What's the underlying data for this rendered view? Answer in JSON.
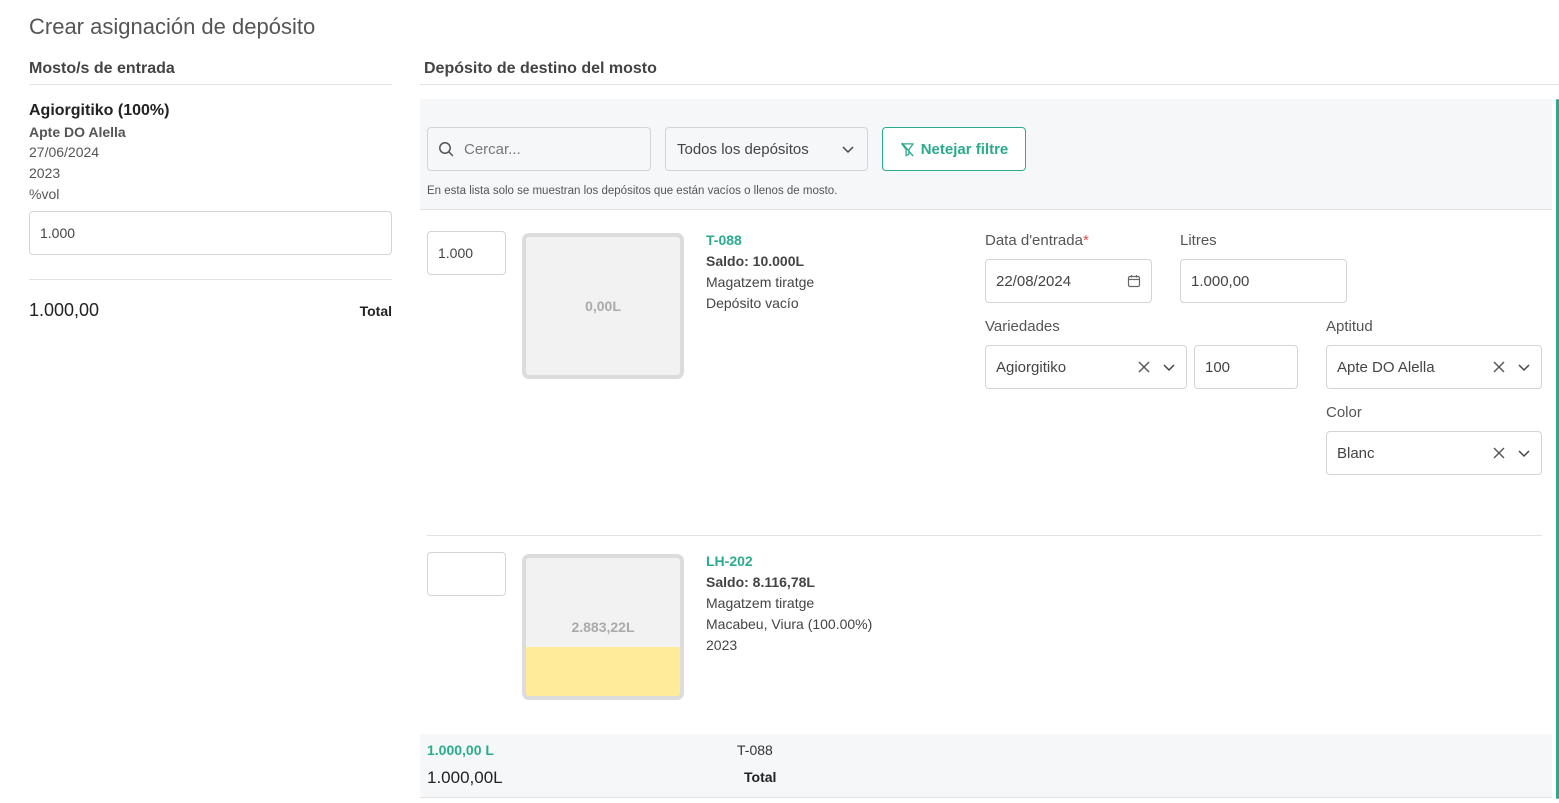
{
  "page": {
    "title": "Crear asignación de depósito"
  },
  "left": {
    "title": "Mosto/s de entrada",
    "must": {
      "name": "Agiorgitiko (100%)",
      "quality": "Apte DO Alella",
      "date": "27/06/2024",
      "year": "2023",
      "vol": "%vol"
    },
    "quantity_value": "1.000",
    "total_value": "1.000,00",
    "total_label": "Total"
  },
  "right": {
    "title": "Depósito de destino del mosto",
    "filter": {
      "search_placeholder": "Cercar...",
      "tank_select": "Todos los depósitos",
      "clear_label": "Netejar filtre",
      "note": "En esta lista solo se muestran los depósitos que están vacíos o llenos de mosto."
    },
    "tanks": [
      {
        "quantity": "1.000",
        "code": "T-088",
        "saldo": "Saldo: 10.000L",
        "warehouse": "Magatzem tiratge",
        "contents": "Depósito vacío",
        "year": "",
        "level_text": "0,00L",
        "fill_fraction": 0,
        "form": {
          "date_label": "Data d'entrada",
          "required_mark": "*",
          "date_value": "22/08/2024",
          "litres_label": "Litres",
          "litres_value": "1.000,00",
          "variety_label": "Variedades",
          "variety_value": "Agiorgitiko",
          "percent_value": "100",
          "aptitude_label": "Aptitud",
          "aptitude_value": "Apte DO Alella",
          "color_label": "Color",
          "color_value": "Blanc"
        }
      },
      {
        "quantity": "",
        "code": "LH-202",
        "saldo": "Saldo: 8.116,78L",
        "warehouse": "Magatzem tiratge",
        "contents": "Macabeu, Viura (100.00%)",
        "year": "2023",
        "level_text": "2.883,22L",
        "fill_fraction": 0.355
      }
    ],
    "summary": {
      "assigned": "1.000,00 L",
      "tank_code": "T-088",
      "total_value": "1.000,00L",
      "total_label": "Total"
    }
  },
  "colors": {
    "accent": "#2bab8e",
    "tank_fill": "#ffeb99",
    "panel_bg": "#f5f7f8"
  },
  "icons": [
    "search-icon",
    "chevron-down-icon",
    "filter-off-icon",
    "calendar-icon",
    "close-icon"
  ]
}
